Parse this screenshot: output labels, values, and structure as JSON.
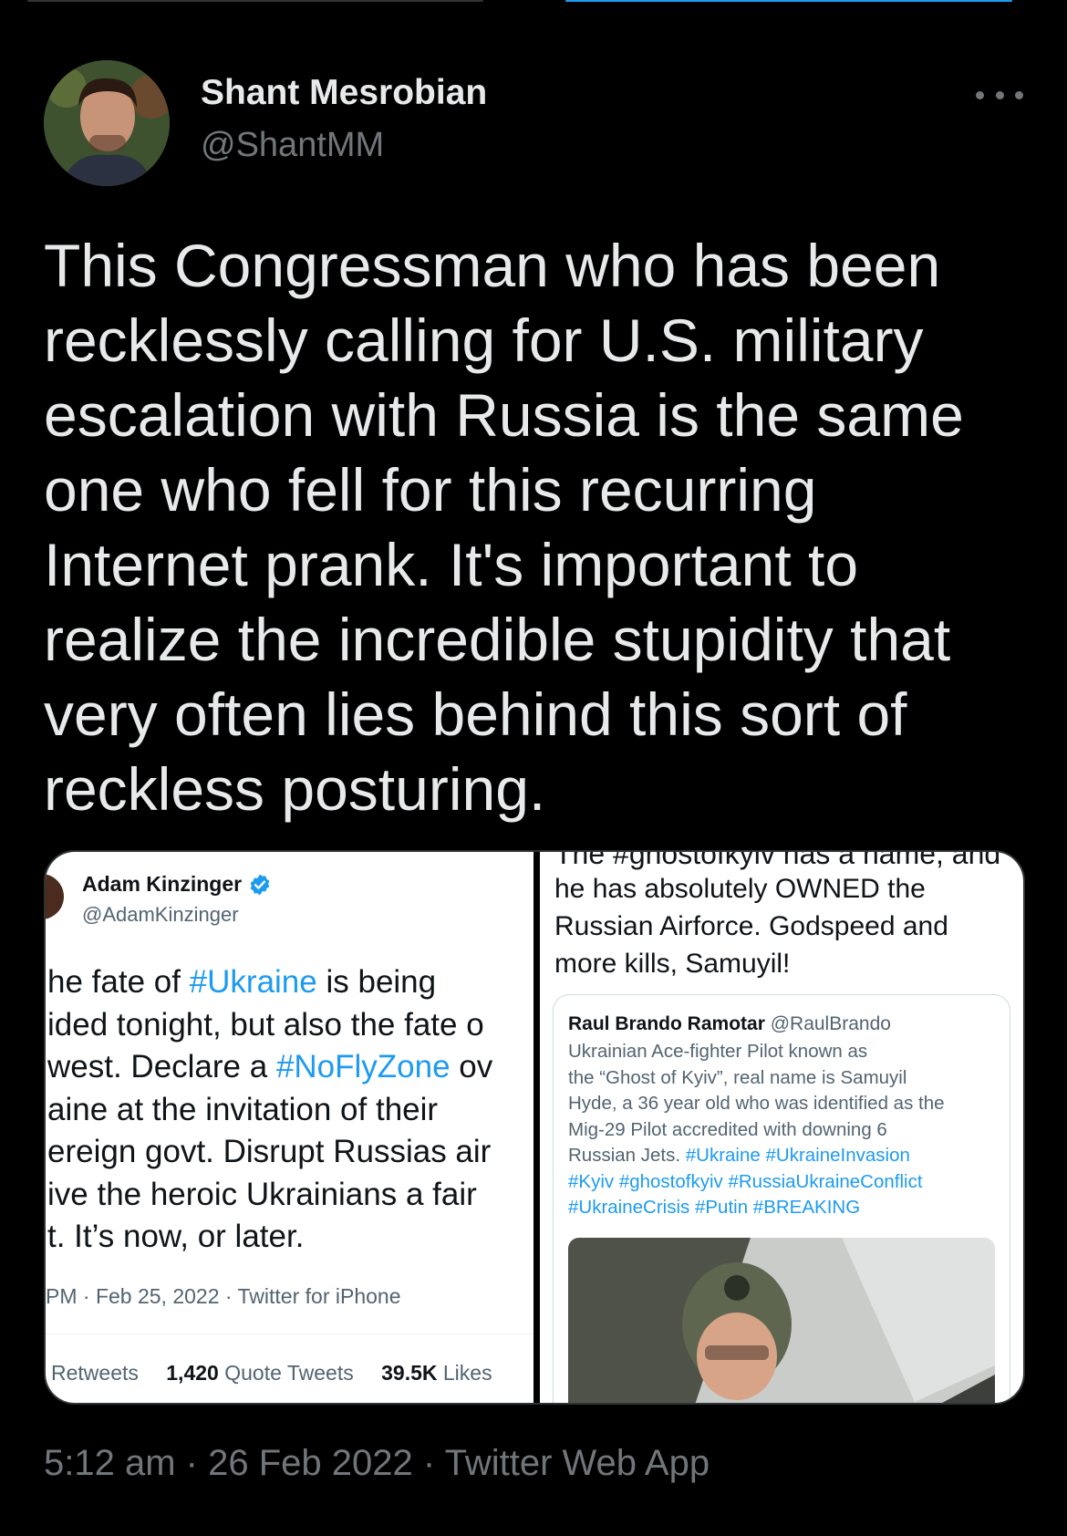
{
  "tweet": {
    "author_name": "Shant Mesrobian",
    "author_handle": "@ShantMM",
    "text_lines": [
      "This Congressman who has been",
      "recklessly calling for U.S. military",
      "escalation with Russia is the same",
      "one who fell for this recurring",
      "Internet prank. It's important to",
      "realize the incredible stupidity that",
      "very often lies behind this sort of",
      "reckless posturing."
    ],
    "footer": {
      "time": "5:12 am",
      "date": "26 Feb 2022",
      "source": "Twitter Web App",
      "separator": "·"
    }
  },
  "embedded_left": {
    "author_name": "Adam Kinzinger",
    "author_handle": "@AdamKinzinger",
    "body": {
      "l1_pre": "he fate of ",
      "l1_tag": "#Ukraine",
      "l1_post": " is being",
      "l2": "ided tonight, but also the fate o",
      "l3_pre": "west. Declare a ",
      "l3_tag": "#NoFlyZone",
      "l3_post": " ov",
      "l4": "aine at the invitation of their",
      "l5": "ereign govt. Disrupt Russias air",
      "l6": "ive the heroic Ukrainians a fair",
      "l7": "t.  It’s now, or later."
    },
    "meta": "PM · Feb 25, 2022 · Twitter for iPhone",
    "stats": {
      "retweets_label": "Retweets",
      "quotes_count": "1,420",
      "quotes_label": "Quote Tweets",
      "likes_count": "39.5K",
      "likes_label": "Likes"
    }
  },
  "embedded_right": {
    "cut_line": "The #ghostofkyiv has a name, and",
    "body_lines": [
      "he has absolutely OWNED the",
      "Russian Airforce.  Godspeed and",
      "more kills, Samuyil!"
    ],
    "quoted": {
      "author_name": "Raul Brando Ramotar",
      "author_handle": "@RaulBrando",
      "text_lines": [
        "Ukrainian Ace-fighter Pilot known as",
        "the “Ghost of Kyiv”, real name is Samuyil",
        "Hyde, a 36 year old who was identified as the",
        "Mig-29 Pilot accredited with downing 6"
      ],
      "l5_pre": "Russian Jets. ",
      "l5_tags": "#Ukraine #UkraineInvasion",
      "l6_tags": "#Kyiv #ghostofkyiv #RussiaUkraineConflict",
      "l7_tags": "#UkraineCrisis #Putin #BREAKING"
    }
  },
  "colors": {
    "background": "#000000",
    "text_primary": "#e7e9ea",
    "text_secondary": "#71767b",
    "link_blue": "#1d9bf0",
    "verified_blue": "#1d9bf0"
  },
  "icons": {
    "more": "more-horizontal-icon",
    "verified": "verified-badge-icon"
  }
}
